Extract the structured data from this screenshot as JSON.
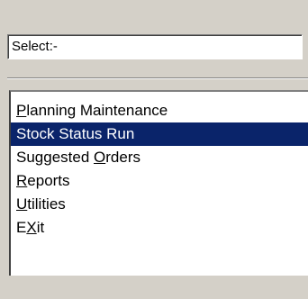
{
  "select": {
    "value": "Select:-"
  },
  "menu": {
    "items": [
      {
        "before": "",
        "accel": "P",
        "after": "lanning Maintenance",
        "selected": false
      },
      {
        "before": "Stock Status Run",
        "accel": "",
        "after": "",
        "selected": true
      },
      {
        "before": "Suggested ",
        "accel": "O",
        "after": "rders",
        "selected": false
      },
      {
        "before": "",
        "accel": "R",
        "after": "eports",
        "selected": false
      },
      {
        "before": "",
        "accel": "U",
        "after": "tilities",
        "selected": false
      },
      {
        "before": "E",
        "accel": "X",
        "after": "it",
        "selected": false
      }
    ]
  },
  "colors": {
    "background": "#d4d0c8",
    "selection": "#0a246a",
    "selection_text": "#ffffff"
  }
}
